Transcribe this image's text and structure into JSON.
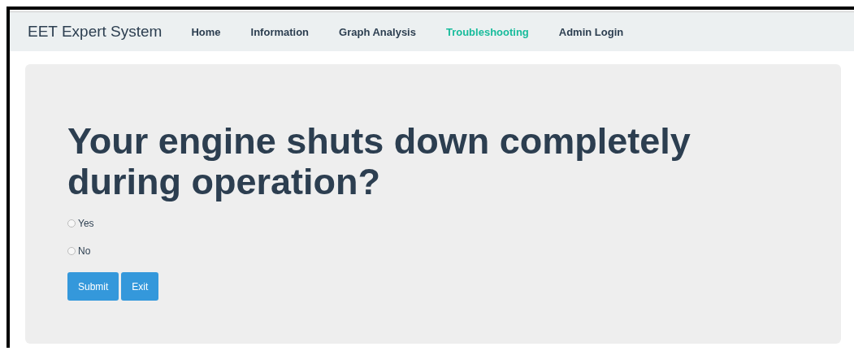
{
  "navbar": {
    "brand": "EET Expert System",
    "links": [
      {
        "label": "Home",
        "selected": false
      },
      {
        "label": "Information",
        "selected": false
      },
      {
        "label": "Graph Analysis",
        "selected": false
      },
      {
        "label": "Troubleshooting",
        "selected": true
      },
      {
        "label": "Admin Login",
        "selected": false
      }
    ]
  },
  "question": {
    "heading": "Your engine shuts down completely during operation?",
    "options": [
      {
        "label": "Yes",
        "selected": false
      },
      {
        "label": "No",
        "selected": false
      }
    ]
  },
  "buttons": [
    "Submit",
    "Exit"
  ]
}
